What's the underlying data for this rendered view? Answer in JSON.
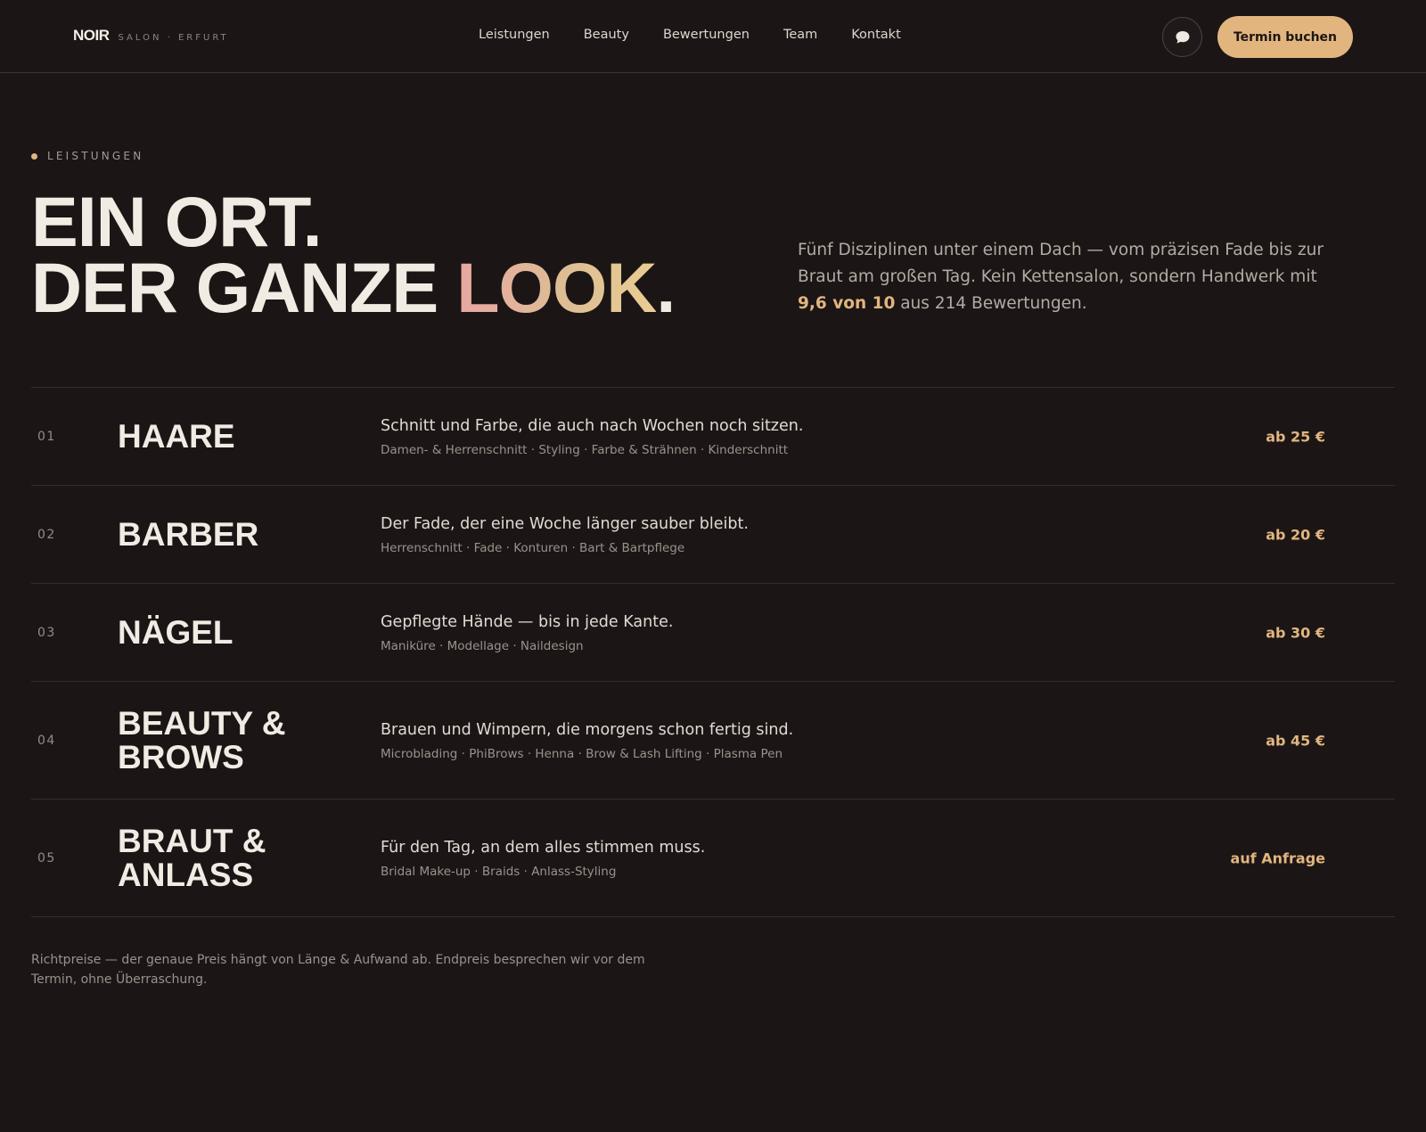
{
  "brand": {
    "logo": "NOIR",
    "subtitle": "SALON · ERFURT"
  },
  "nav": [
    {
      "label": "Leistungen"
    },
    {
      "label": "Beauty"
    },
    {
      "label": "Bewertungen"
    },
    {
      "label": "Team"
    },
    {
      "label": "Kontakt"
    }
  ],
  "header": {
    "chat_icon": "chat-bubble-icon",
    "cta_label": "Termin buchen"
  },
  "intro": {
    "eyebrow": "LEISTUNGEN",
    "headline_line1": "EIN ORT.",
    "headline_line2_prefix": "DER GANZE ",
    "headline_line2_accent": "LOOK",
    "headline_line2_suffix": ".",
    "lead_text": "Fünf Disziplinen unter einem Dach — vom präzisen Fade bis zur Braut am großen Tag. Kein Kettensalon, sondern Handwerk mit ",
    "lead_score": "9,6 von 10",
    "lead_suffix": " aus 214 Bewertungen."
  },
  "services": [
    {
      "num": "01",
      "title": "HAARE",
      "desc": "Schnitt und Farbe, die auch nach Wochen noch sitzen.",
      "tags": "Damen- & Herrenschnitt · Styling · Farbe & Strähnen · Kinderschnitt",
      "price": "ab 25 €"
    },
    {
      "num": "02",
      "title": "BARBER",
      "desc": "Der Fade, der eine Woche länger sauber bleibt.",
      "tags": "Herrenschnitt · Fade · Konturen · Bart & Bartpflege",
      "price": "ab 20 €"
    },
    {
      "num": "03",
      "title": "NÄGEL",
      "desc": "Gepflegte Hände — bis in jede Kante.",
      "tags": "Maniküre · Modellage · Naildesign",
      "price": "ab 30 €"
    },
    {
      "num": "04",
      "title": "BEAUTY & BROWS",
      "desc": "Brauen und Wimpern, die morgens schon fertig sind.",
      "tags": "Microblading · PhiBrows · Henna · Brow & Lash Lifting · Plasma Pen",
      "price": "ab 45 €"
    },
    {
      "num": "05",
      "title": "BRAUT & ANLASS",
      "desc": "Für den Tag, an dem alles stimmen muss.",
      "tags": "Bridal Make-up · Braids · Anlass-Styling",
      "price": "auf Anfrage"
    }
  ],
  "footnote": "Richtpreise — der genaue Preis hängt von Länge & Aufwand ab. Endpreis besprechen wir vor dem Termin, ohne Überraschung.",
  "colors": {
    "background": "#1b1615",
    "accent": "#e2b57f",
    "text": "#f2ebe4"
  }
}
